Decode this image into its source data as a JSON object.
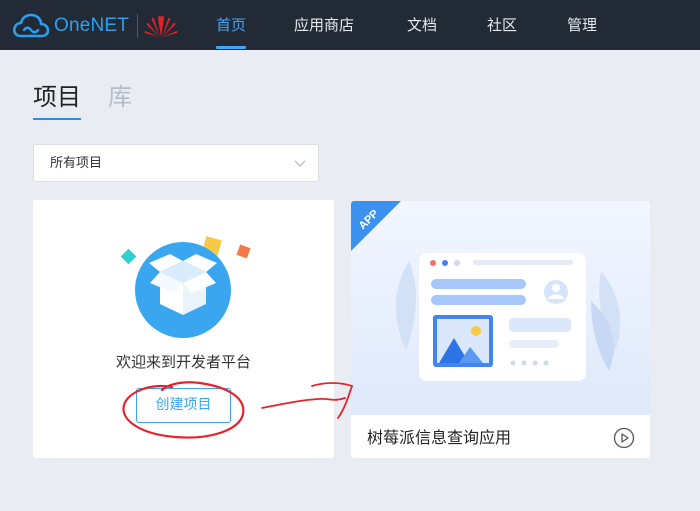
{
  "brand": {
    "name": "OneNET"
  },
  "nav": [
    {
      "label": "首页",
      "active": true
    },
    {
      "label": "应用商店",
      "active": false
    },
    {
      "label": "文档",
      "active": false
    },
    {
      "label": "社区",
      "active": false
    },
    {
      "label": "管理",
      "active": false
    }
  ],
  "tabs": [
    {
      "label": "项目",
      "active": true
    },
    {
      "label": "库",
      "active": false
    }
  ],
  "filter": {
    "selected": "所有项目"
  },
  "welcome_card": {
    "text": "欢迎来到开发者平台",
    "button": "创建项目"
  },
  "app_card": {
    "badge": "APP",
    "title": "树莓派信息查询应用"
  },
  "colors": {
    "topbar": "#222a35",
    "accent": "#3ea6ff",
    "annotation": "#e8222a"
  }
}
